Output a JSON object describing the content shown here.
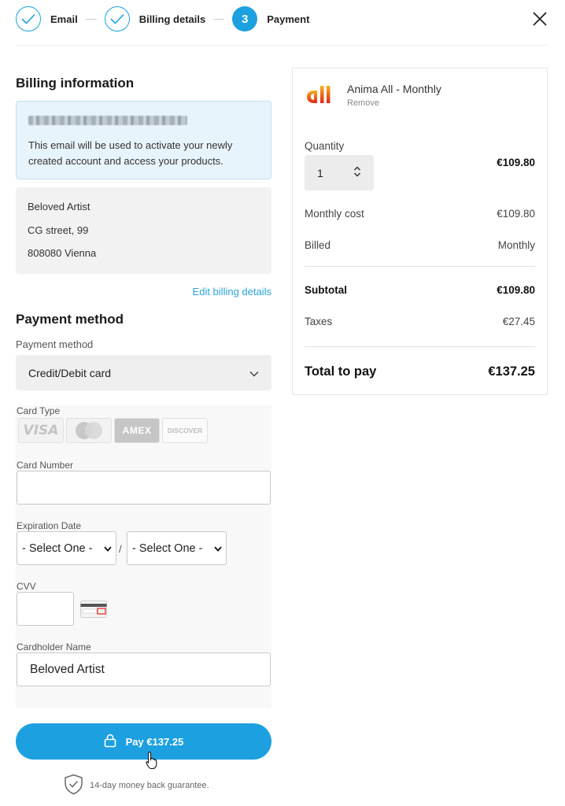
{
  "stepper": {
    "steps": [
      {
        "label": "Email",
        "state": "done"
      },
      {
        "label": "Billing details",
        "state": "done"
      },
      {
        "label": "Payment",
        "number": "3",
        "state": "active"
      }
    ]
  },
  "billing": {
    "title": "Billing information",
    "email_note": "This email will be used to activate your newly created account and access your products.",
    "address": [
      "Beloved Artist",
      "CG street, 99",
      "808080 Vienna"
    ],
    "edit_link": "Edit billing details"
  },
  "payment": {
    "title": "Payment method",
    "method_label": "Payment method",
    "method_value": "Credit/Debit card",
    "card_type_label": "Card Type",
    "card_types": [
      "VISA",
      "mastercard",
      "AMEX",
      "DISCOVER"
    ],
    "card_number_label": "Card Number",
    "card_number_value": "",
    "expiration_label": "Expiration Date",
    "exp_month": "- Select One -",
    "exp_separator": "/",
    "exp_year": "- Select One -",
    "cvv_label": "CVV",
    "cvv_value": "",
    "cvv_icon_text": "XXXX XXX",
    "holder_label": "Cardholder Name",
    "holder_value": "Beloved Artist",
    "pay_button": "Pay €137.25",
    "guarantee": "14-day money back guarantee."
  },
  "summary": {
    "product_name": "Anima All - Monthly",
    "remove": "Remove",
    "quantity_label": "Quantity",
    "quantity": "1",
    "line_price": "€109.80",
    "monthly_cost_label": "Monthly cost",
    "monthly_cost": "€109.80",
    "billed_label": "Billed",
    "billed": "Monthly",
    "subtotal_label": "Subtotal",
    "subtotal": "€109.80",
    "taxes_label": "Taxes",
    "taxes": "€27.45",
    "total_label": "Total to pay",
    "total": "€137.25"
  },
  "colors": {
    "accent": "#1ca0e0",
    "link": "#2aa2dc",
    "info_bg": "#e8f4fb",
    "logo_orange": "#f39a1b",
    "logo_red": "#e2231a"
  }
}
